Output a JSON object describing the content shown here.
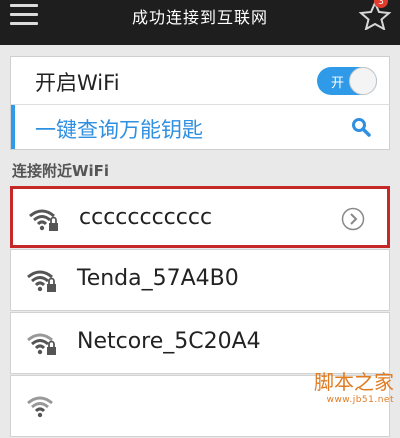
{
  "topbar": {
    "title": "成功连接到互联网",
    "badge": "3"
  },
  "wifi_toggle": {
    "label": "开启WiFi",
    "state_text": "开",
    "on": true
  },
  "key_query": {
    "label": "一键查询万能钥匙"
  },
  "section": {
    "title": "连接附近WiFi"
  },
  "networks": [
    {
      "name": "ccccccccccc",
      "selected": true,
      "icon": "wifi-lock-icon",
      "has_arrow": true
    },
    {
      "name": "Tenda_57A4B0",
      "selected": false,
      "icon": "wifi-lock-icon"
    },
    {
      "name": "Netcore_5C20A4",
      "selected": false,
      "icon": "wifi-lock-icon"
    },
    {
      "name": "",
      "selected": false,
      "icon": "wifi-lock-icon"
    }
  ],
  "watermark": {
    "main": "脚本之家",
    "sub": "www.jb51.net"
  },
  "colors": {
    "accent": "#2f9be8",
    "highlight_border": "#c62828",
    "topbar": "#1e1e1e"
  }
}
